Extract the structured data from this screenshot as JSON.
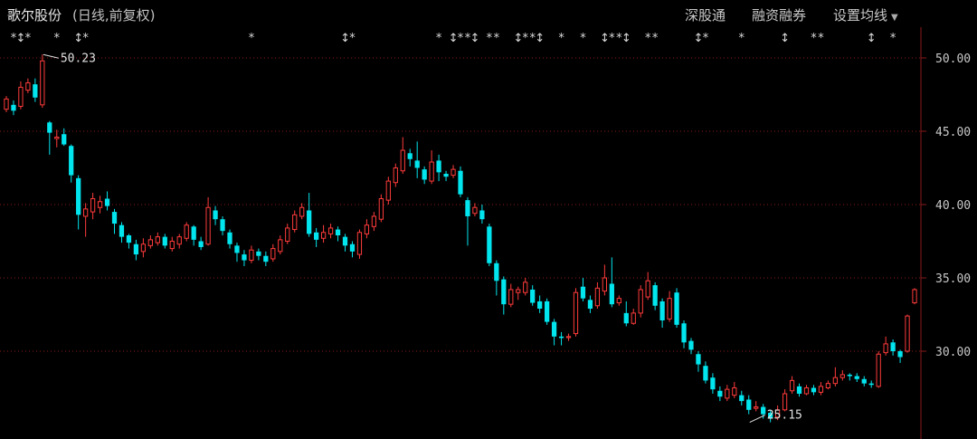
{
  "header": {
    "stock_name": "歌尔股份",
    "subtitle": "(日线,前复权)",
    "links": [
      "深股通",
      "融资融券",
      "设置均线"
    ],
    "settings_caret": "▼"
  },
  "colors": {
    "background": "#000000",
    "up": "#ff3b3b",
    "down": "#00e5ee",
    "grid": "#8b1a1a",
    "text": "#c8c8c8",
    "marker": "#d8d8d8"
  },
  "event_markers": [
    "***",
    "↕",
    "**",
    "*",
    "↕*",
    "↕",
    "****",
    "**",
    "****",
    "↕",
    "↕",
    "****",
    "**",
    "**",
    "*",
    "↕",
    "**",
    "*",
    "↕"
  ],
  "chart_data": {
    "type": "candlestick",
    "ylim": [
      25,
      50.5
    ],
    "yticks": [
      "50.00",
      "45.00",
      "40.00",
      "35.00",
      "30.00"
    ],
    "grid": true,
    "annotations": [
      {
        "label": "50.23",
        "index": 5,
        "value": 50.23
      },
      {
        "label": "25.15",
        "index": 103,
        "value": 25.15
      }
    ],
    "candles": [
      [
        46.5,
        47.2,
        47.4,
        46.3
      ],
      [
        46.8,
        46.4,
        47.1,
        46.1
      ],
      [
        46.7,
        48.0,
        48.4,
        46.5
      ],
      [
        47.8,
        48.3,
        48.6,
        47.6
      ],
      [
        48.2,
        47.3,
        48.6,
        47.0
      ],
      [
        46.8,
        49.8,
        50.23,
        46.6
      ],
      [
        45.6,
        44.9,
        45.7,
        43.4
      ],
      [
        44.5,
        44.6,
        45.1,
        43.9
      ],
      [
        44.8,
        44.1,
        45.2,
        44.0
      ],
      [
        44.0,
        42.0,
        44.1,
        41.5
      ],
      [
        41.8,
        39.3,
        42.0,
        38.3
      ],
      [
        39.2,
        39.7,
        40.1,
        37.8
      ],
      [
        39.5,
        40.4,
        40.8,
        39.0
      ],
      [
        39.8,
        40.2,
        40.6,
        39.4
      ],
      [
        40.4,
        39.9,
        40.9,
        39.6
      ],
      [
        39.5,
        38.7,
        39.7,
        38.0
      ],
      [
        38.6,
        37.8,
        38.8,
        37.4
      ],
      [
        37.9,
        37.4,
        38.0,
        37.0
      ],
      [
        37.3,
        36.6,
        37.6,
        36.2
      ],
      [
        36.8,
        37.3,
        37.7,
        36.4
      ],
      [
        37.2,
        37.6,
        37.9,
        37.0
      ],
      [
        37.4,
        37.8,
        38.1,
        37.2
      ],
      [
        37.8,
        37.2,
        38.0,
        37.0
      ],
      [
        37.0,
        37.5,
        37.8,
        36.8
      ],
      [
        37.3,
        37.8,
        38.0,
        37.0
      ],
      [
        37.7,
        38.6,
        38.8,
        37.5
      ],
      [
        38.5,
        37.6,
        38.6,
        37.2
      ],
      [
        37.5,
        37.1,
        37.8,
        36.9
      ],
      [
        37.3,
        39.8,
        40.5,
        37.2
      ],
      [
        39.6,
        39.0,
        39.9,
        38.6
      ],
      [
        39.0,
        38.2,
        39.2,
        37.9
      ],
      [
        38.1,
        37.3,
        38.3,
        37.0
      ],
      [
        37.2,
        36.7,
        37.4,
        36.1
      ],
      [
        36.6,
        36.2,
        36.9,
        35.8
      ],
      [
        36.2,
        36.9,
        37.2,
        36.0
      ],
      [
        36.8,
        36.5,
        37.0,
        36.2
      ],
      [
        36.5,
        36.1,
        36.8,
        35.8
      ],
      [
        36.3,
        37.0,
        37.3,
        36.1
      ],
      [
        36.8,
        37.6,
        37.9,
        36.6
      ],
      [
        37.5,
        38.4,
        38.7,
        37.3
      ],
      [
        38.3,
        39.3,
        39.6,
        38.1
      ],
      [
        39.2,
        39.8,
        40.1,
        39.0
      ],
      [
        39.6,
        38.0,
        40.8,
        37.8
      ],
      [
        38.1,
        37.6,
        38.4,
        37.1
      ],
      [
        37.7,
        38.1,
        38.6,
        37.4
      ],
      [
        38.0,
        38.4,
        38.7,
        37.7
      ],
      [
        38.3,
        37.9,
        38.5,
        37.5
      ],
      [
        37.8,
        37.2,
        38.0,
        36.8
      ],
      [
        37.3,
        36.8,
        37.5,
        36.4
      ],
      [
        36.6,
        38.1,
        38.3,
        36.3
      ],
      [
        38.0,
        38.6,
        39.0,
        37.7
      ],
      [
        38.5,
        39.2,
        39.5,
        38.2
      ],
      [
        39.0,
        40.4,
        40.7,
        38.8
      ],
      [
        40.3,
        41.6,
        41.9,
        40.0
      ],
      [
        41.5,
        42.5,
        42.8,
        41.2
      ],
      [
        42.3,
        43.7,
        44.6,
        42.1
      ],
      [
        43.5,
        43.1,
        43.8,
        42.6
      ],
      [
        43.0,
        42.5,
        44.3,
        41.8
      ],
      [
        42.4,
        41.7,
        42.6,
        41.4
      ],
      [
        41.6,
        42.9,
        43.7,
        41.4
      ],
      [
        43.0,
        42.2,
        43.4,
        41.6
      ],
      [
        42.1,
        41.9,
        42.3,
        41.6
      ],
      [
        42.0,
        42.4,
        42.7,
        41.8
      ],
      [
        42.3,
        40.7,
        42.6,
        40.5
      ],
      [
        40.3,
        39.2,
        40.5,
        37.2
      ],
      [
        39.4,
        39.8,
        40.1,
        39.2
      ],
      [
        39.6,
        39.0,
        40.0,
        38.7
      ],
      [
        38.5,
        36.0,
        38.7,
        35.8
      ],
      [
        36.0,
        34.8,
        36.2,
        33.8
      ],
      [
        34.9,
        33.2,
        35.1,
        32.5
      ],
      [
        33.2,
        34.2,
        34.6,
        33.0
      ],
      [
        34.0,
        34.2,
        34.4,
        33.5
      ],
      [
        34.0,
        34.7,
        35.0,
        33.8
      ],
      [
        34.2,
        33.3,
        34.5,
        33.1
      ],
      [
        33.4,
        32.9,
        33.8,
        32.6
      ],
      [
        33.4,
        32.0,
        33.6,
        31.8
      ],
      [
        32.0,
        31.0,
        32.2,
        30.4
      ],
      [
        31.0,
        30.9,
        31.3,
        30.4
      ],
      [
        31.0,
        31.0,
        31.2,
        30.7
      ],
      [
        31.2,
        34.0,
        34.3,
        31.0
      ],
      [
        34.4,
        33.6,
        35.0,
        33.4
      ],
      [
        33.5,
        32.9,
        33.8,
        32.6
      ],
      [
        33.1,
        34.3,
        34.7,
        32.9
      ],
      [
        34.1,
        35.0,
        35.9,
        33.8
      ],
      [
        34.6,
        33.2,
        36.4,
        33.0
      ],
      [
        33.3,
        33.6,
        33.8,
        33.1
      ],
      [
        32.6,
        31.9,
        33.4,
        31.7
      ],
      [
        31.9,
        32.6,
        32.9,
        31.8
      ],
      [
        32.6,
        34.2,
        34.5,
        32.3
      ],
      [
        33.7,
        34.8,
        35.4,
        33.5
      ],
      [
        34.5,
        33.1,
        34.7,
        32.8
      ],
      [
        33.4,
        32.1,
        33.6,
        31.6
      ],
      [
        32.2,
        33.6,
        34.1,
        32.0
      ],
      [
        34.0,
        31.8,
        34.3,
        31.6
      ],
      [
        31.9,
        30.6,
        32.1,
        30.2
      ],
      [
        30.7,
        30.1,
        30.9,
        29.8
      ],
      [
        29.8,
        29.1,
        30.0,
        28.6
      ],
      [
        29.0,
        28.0,
        29.3,
        27.8
      ],
      [
        28.2,
        27.4,
        28.5,
        27.1
      ],
      [
        27.3,
        26.9,
        27.6,
        26.6
      ],
      [
        26.8,
        27.4,
        27.7,
        26.6
      ],
      [
        27.0,
        27.5,
        27.9,
        26.8
      ],
      [
        27.0,
        26.6,
        27.3,
        26.3
      ],
      [
        26.7,
        26.0,
        27.0,
        25.7
      ],
      [
        26.1,
        26.2,
        26.6,
        25.9
      ],
      [
        26.2,
        25.7,
        26.4,
        25.4
      ],
      [
        25.8,
        25.4,
        26.0,
        25.15
      ],
      [
        25.5,
        26.0,
        26.3,
        25.3
      ],
      [
        26.0,
        27.1,
        27.4,
        25.9
      ],
      [
        27.3,
        28.0,
        28.3,
        27.1
      ],
      [
        27.6,
        27.1,
        27.8,
        26.9
      ],
      [
        27.1,
        27.5,
        27.7,
        27.0
      ],
      [
        27.5,
        27.2,
        27.7,
        27.0
      ],
      [
        27.2,
        27.6,
        27.9,
        27.0
      ],
      [
        27.5,
        27.8,
        28.0,
        27.4
      ],
      [
        27.8,
        28.2,
        28.9,
        27.6
      ],
      [
        28.2,
        28.4,
        28.7,
        28.0
      ],
      [
        28.4,
        28.3,
        28.5,
        28.0
      ],
      [
        28.3,
        28.1,
        28.5,
        27.9
      ],
      [
        28.1,
        27.8,
        28.3,
        27.6
      ],
      [
        27.8,
        27.7,
        28.0,
        27.5
      ],
      [
        27.6,
        29.8,
        30.0,
        27.5
      ],
      [
        29.9,
        30.5,
        31.0,
        29.7
      ],
      [
        30.6,
        30.0,
        30.8,
        29.7
      ],
      [
        30.0,
        29.6,
        30.1,
        29.2
      ],
      [
        30.0,
        32.4,
        32.5,
        29.9
      ],
      [
        33.3,
        34.2,
        34.3,
        33.2
      ]
    ],
    "marker_positions": [
      0,
      1,
      2,
      6,
      9,
      10,
      33,
      46,
      47,
      59,
      61,
      62,
      63,
      64,
      66,
      67,
      70,
      71,
      72,
      73,
      76,
      79,
      82,
      83,
      84,
      85,
      88,
      89,
      95,
      96,
      101,
      107,
      111,
      112,
      119,
      122
    ]
  }
}
